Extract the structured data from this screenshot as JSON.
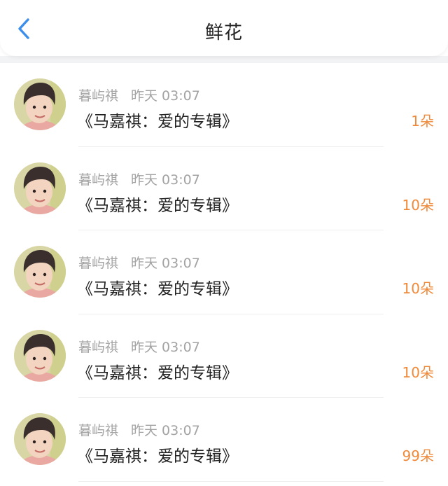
{
  "header": {
    "title": "鲜花",
    "back_icon": "chevron-left-icon",
    "accent_color": "#3b8eea"
  },
  "flowers": {
    "count_color": "#f08a3a",
    "items": [
      {
        "user": "暮屿祺",
        "time": "昨天 03:07",
        "album": "《马嘉祺：爱的专辑》",
        "count": "1朵"
      },
      {
        "user": "暮屿祺",
        "time": "昨天 03:07",
        "album": "《马嘉祺：爱的专辑》",
        "count": "10朵"
      },
      {
        "user": "暮屿祺",
        "time": "昨天 03:07",
        "album": "《马嘉祺：爱的专辑》",
        "count": "10朵"
      },
      {
        "user": "暮屿祺",
        "time": "昨天 03:07",
        "album": "《马嘉祺：爱的专辑》",
        "count": "10朵"
      },
      {
        "user": "暮屿祺",
        "time": "昨天 03:07",
        "album": "《马嘉祺：爱的专辑》",
        "count": "99朵"
      }
    ]
  }
}
